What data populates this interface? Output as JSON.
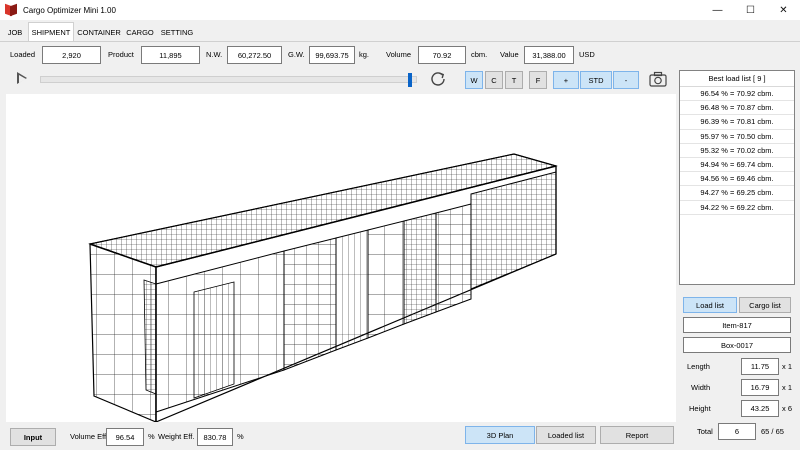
{
  "app": {
    "title": "Cargo Optimizer Mini 1.00"
  },
  "window_controls": {
    "minimize": "—",
    "maximize": "☐",
    "close": "✕"
  },
  "tabs": [
    {
      "label": "JOB"
    },
    {
      "label": "SHIPMENT"
    },
    {
      "label": "CONTAINER"
    },
    {
      "label": "CARGO"
    },
    {
      "label": "SETTING"
    }
  ],
  "stats": {
    "loaded_label": "Loaded",
    "loaded_value": "2,920",
    "product_label": "Product",
    "product_value": "11,895",
    "nw_label": "N.W.",
    "nw_value": "60,272.50",
    "gw_label": "G.W.",
    "gw_value": "99,693.75",
    "gw_unit": "kg.",
    "volume_label": "Volume",
    "volume_value": "70.92",
    "volume_unit": "cbm.",
    "value_label": "Value",
    "value_value": "31,388.00",
    "value_unit": "USD"
  },
  "playback": {
    "progress_fraction": 0.99,
    "play_icon": "play-icon",
    "refresh_icon": "refresh-icon"
  },
  "view_buttons": [
    {
      "label": "W",
      "selected": true
    },
    {
      "label": "C",
      "selected": false
    },
    {
      "label": "T",
      "selected": false
    },
    {
      "label": "F",
      "selected": false
    },
    {
      "label": "+",
      "selected": true
    },
    {
      "label": "STD",
      "selected": true
    },
    {
      "label": "-",
      "selected": true
    }
  ],
  "best_load_list": {
    "header": "Best load list [ 9 ]",
    "items": [
      "96.54 % = 70.92 cbm.",
      "96.48 % = 70.87 cbm.",
      "96.39 % = 70.81 cbm.",
      "95.97 % = 70.50 cbm.",
      "95.32 % = 70.02 cbm.",
      "94.94 % = 69.74 cbm.",
      "94.56 % = 69.46 cbm.",
      "94.27 % = 69.25 cbm.",
      "94.22 % = 69.22 cbm."
    ]
  },
  "right_controls": {
    "load_list_btn": "Load list",
    "cargo_list_btn": "Cargo list",
    "item_name": "Item-817",
    "box_name": "Box-0017",
    "length_label": "Length",
    "length_value": "11.75",
    "length_mult": "x 1",
    "width_label": "Width",
    "width_value": "16.79",
    "width_mult": "x 1",
    "height_label": "Height",
    "height_value": "43.25",
    "height_mult": "x 6",
    "total_label": "Total",
    "total_value": "6",
    "total_count": "65 / 65"
  },
  "bottom": {
    "input_btn": "Input",
    "volume_eff_label": "Volume Eff.",
    "volume_eff_value": "96.54",
    "volume_eff_unit": "%",
    "weight_eff_label": "Weight Eff.",
    "weight_eff_value": "830.78",
    "weight_eff_unit": "%",
    "plan_btn": "3D Plan",
    "loaded_list_btn": "Loaded list",
    "report_btn": "Report"
  },
  "colors": {
    "accent": "#0a64c8",
    "selected_bg": "#cce4f7",
    "window_bg": "#f0f0f0"
  }
}
